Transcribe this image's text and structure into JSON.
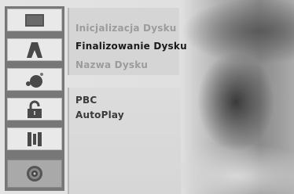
{
  "sidebar": {
    "items": [
      {
        "icon": "disc-square-icon",
        "selected": false
      },
      {
        "icon": "record-a-icon",
        "selected": false
      },
      {
        "icon": "speaker-sound-icon",
        "selected": false
      },
      {
        "icon": "padlock-icon",
        "selected": false
      },
      {
        "icon": "film-strip-icon",
        "selected": false
      },
      {
        "icon": "disc-icon",
        "selected": true
      }
    ]
  },
  "disc_menu": {
    "items": [
      {
        "label": "Inicjalizacja Dysku",
        "state": "disabled"
      },
      {
        "label": "Finalizowanie Dysku",
        "state": "highlighted"
      },
      {
        "label": "Nazwa Dysku",
        "state": "disabled"
      }
    ]
  },
  "playback_menu": {
    "items": [
      {
        "label": "PBC",
        "state": "normal"
      },
      {
        "label": "AutoPlay",
        "state": "normal"
      }
    ]
  }
}
